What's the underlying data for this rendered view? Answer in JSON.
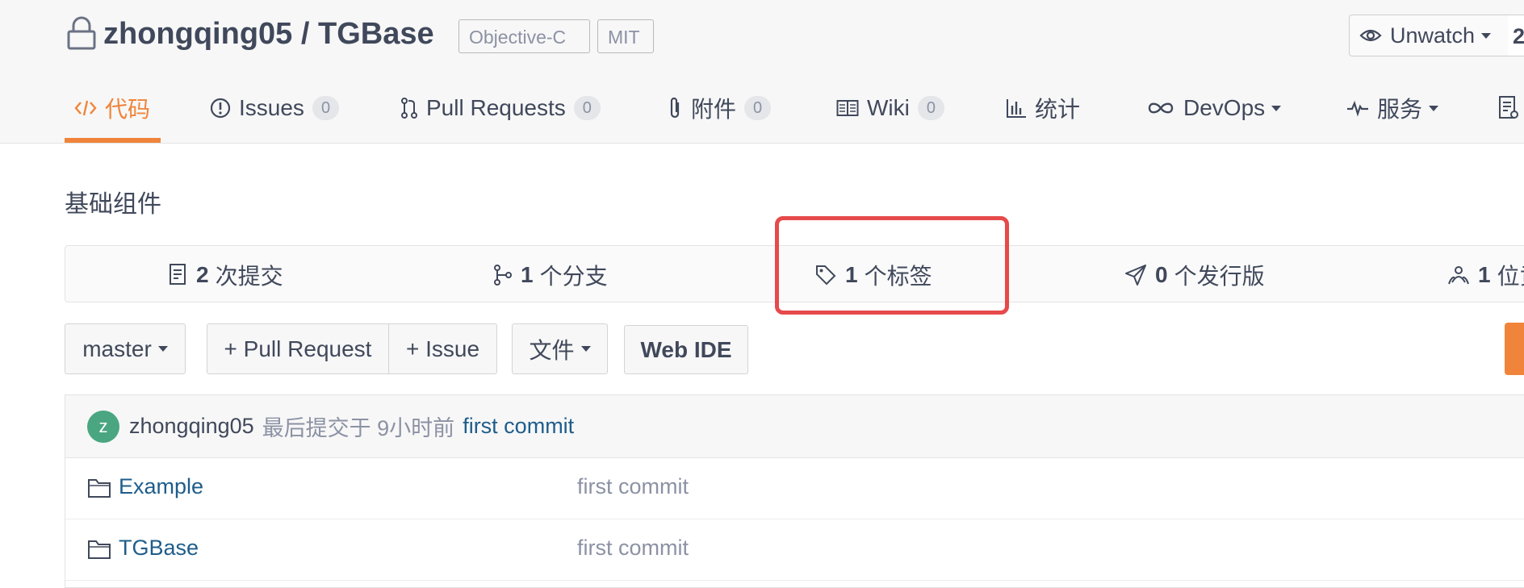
{
  "repo": {
    "title": "zhongqing05 / TGBase",
    "language": "Objective-C",
    "license": "MIT",
    "description": "基础组件"
  },
  "watch": {
    "label": "Unwatch",
    "count": "2"
  },
  "tabs": [
    {
      "label": "代码",
      "icon": "code-icon",
      "active": true
    },
    {
      "label": "Issues",
      "count": "0",
      "icon": "issues-icon"
    },
    {
      "label": "Pull Requests",
      "count": "0",
      "icon": "pull-request-icon"
    },
    {
      "label": "附件",
      "count": "0",
      "icon": "paperclip-icon"
    },
    {
      "label": "Wiki",
      "count": "0",
      "icon": "book-icon"
    },
    {
      "label": "统计",
      "icon": "bar-chart-icon"
    },
    {
      "label": "DevOps",
      "icon": "infinity-icon"
    },
    {
      "label": "服务",
      "icon": "pulse-icon"
    }
  ],
  "stats": [
    {
      "count": "2",
      "label": "次提交",
      "icon": "commits-icon"
    },
    {
      "count": "1",
      "label": "个分支",
      "icon": "branch-icon"
    },
    {
      "count": "1",
      "label": "个标签",
      "icon": "tag-icon"
    },
    {
      "count": "0",
      "label": "个发行版",
      "icon": "release-icon"
    },
    {
      "count": "1",
      "label": "位贡",
      "icon": "contributors-icon"
    }
  ],
  "actions": {
    "branch": "master",
    "pull_request": "+ Pull Request",
    "issue": "+ Issue",
    "file": "文件",
    "web_ide": "Web IDE"
  },
  "last_commit": {
    "avatar_letter": "z",
    "author": "zhongqing05",
    "meta": "最后提交于 9小时前",
    "message": "first commit"
  },
  "files": [
    {
      "name": "Example",
      "commit": "first commit",
      "icon": "folder-icon"
    },
    {
      "name": "TGBase",
      "commit": "first commit",
      "icon": "folder-icon"
    }
  ],
  "colors": {
    "accent": "#f0843a",
    "highlight": "#e64a4a",
    "link": "#1e5d8b",
    "avatar": "#4aa680"
  }
}
